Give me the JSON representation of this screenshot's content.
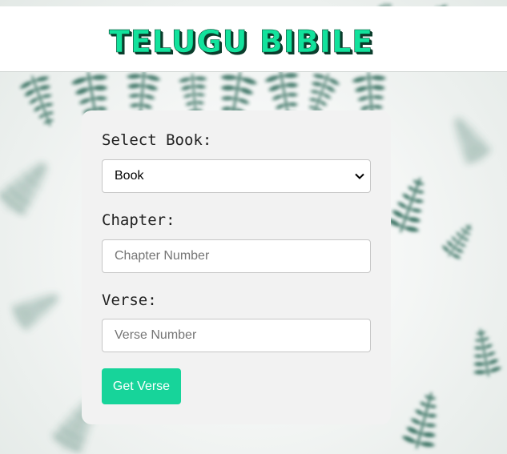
{
  "header": {
    "title": "TELUGU BIBILE"
  },
  "form": {
    "book_label": "Select Book:",
    "book_selected": "Book",
    "chapter_label": "Chapter:",
    "chapter_placeholder": "Chapter Number",
    "verse_label": "Verse:",
    "verse_placeholder": "Verse Number",
    "submit_label": "Get Verse"
  },
  "colors": {
    "accent": "#17d49a",
    "title": "#12e29c",
    "title_shadow": "#0b3d2c",
    "card": "#f2f2f2",
    "leaf": "#2f6b5a"
  },
  "icons": {
    "select_arrow": "chevron-down-icon",
    "background": "fern-leaf-icon"
  }
}
